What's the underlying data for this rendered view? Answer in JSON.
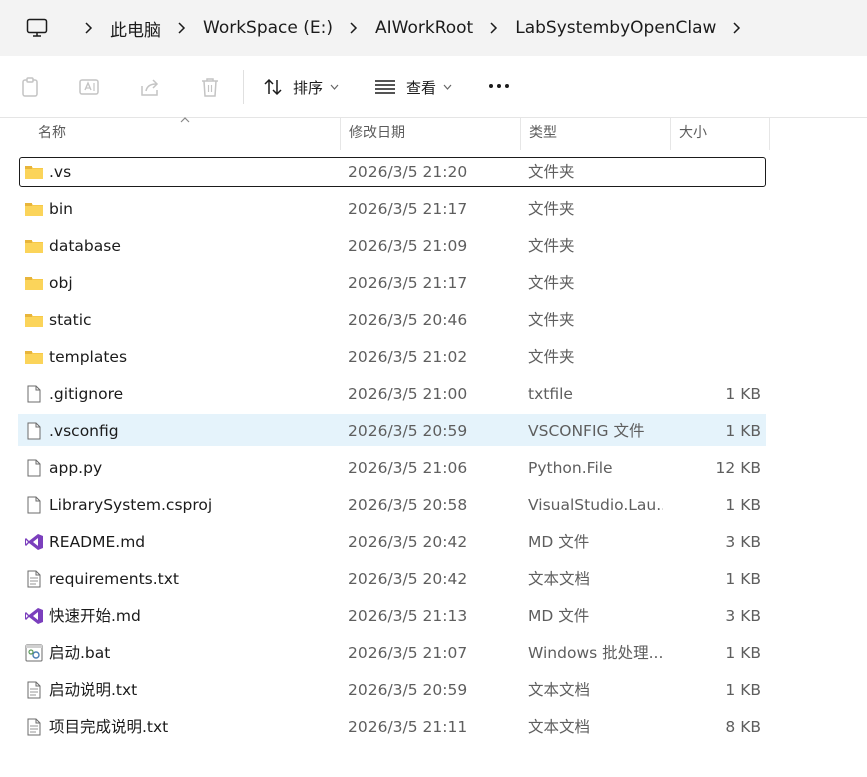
{
  "address": {
    "crumbs": [
      "此电脑",
      "WorkSpace (E:)",
      "AIWorkRoot",
      "LabSystembyOpenClaw"
    ]
  },
  "toolbar": {
    "sort_label": "排序",
    "view_label": "查看"
  },
  "columns": {
    "name": "名称",
    "date": "修改日期",
    "type": "类型",
    "size": "大小"
  },
  "files": [
    {
      "name": ".vs",
      "date": "2026/3/5 21:20",
      "type": "文件夹",
      "size": "",
      "icon": "folder-icon"
    },
    {
      "name": "bin",
      "date": "2026/3/5 21:17",
      "type": "文件夹",
      "size": "",
      "icon": "folder-icon"
    },
    {
      "name": "database",
      "date": "2026/3/5 21:09",
      "type": "文件夹",
      "size": "",
      "icon": "folder-icon"
    },
    {
      "name": "obj",
      "date": "2026/3/5 21:17",
      "type": "文件夹",
      "size": "",
      "icon": "folder-icon"
    },
    {
      "name": "static",
      "date": "2026/3/5 20:46",
      "type": "文件夹",
      "size": "",
      "icon": "folder-icon"
    },
    {
      "name": "templates",
      "date": "2026/3/5 21:02",
      "type": "文件夹",
      "size": "",
      "icon": "folder-icon"
    },
    {
      "name": ".gitignore",
      "date": "2026/3/5 21:00",
      "type": "txtfile",
      "size": "1 KB",
      "icon": "file-icon"
    },
    {
      "name": ".vsconfig",
      "date": "2026/3/5 20:59",
      "type": "VSCONFIG 文件",
      "size": "1 KB",
      "icon": "file-icon"
    },
    {
      "name": "app.py",
      "date": "2026/3/5 21:06",
      "type": "Python.File",
      "size": "12 KB",
      "icon": "file-icon"
    },
    {
      "name": "LibrarySystem.csproj",
      "date": "2026/3/5 20:58",
      "type": "VisualStudio.Lau...",
      "size": "1 KB",
      "icon": "file-icon"
    },
    {
      "name": "README.md",
      "date": "2026/3/5 20:42",
      "type": "MD 文件",
      "size": "3 KB",
      "icon": "visual-studio-icon"
    },
    {
      "name": "requirements.txt",
      "date": "2026/3/5 20:42",
      "type": "文本文档",
      "size": "1 KB",
      "icon": "text-file-icon"
    },
    {
      "name": "快速开始.md",
      "date": "2026/3/5 21:13",
      "type": "MD 文件",
      "size": "3 KB",
      "icon": "visual-studio-icon"
    },
    {
      "name": "启动.bat",
      "date": "2026/3/5 21:07",
      "type": "Windows 批处理...",
      "size": "1 KB",
      "icon": "batch-file-icon"
    },
    {
      "name": "启动说明.txt",
      "date": "2026/3/5 20:59",
      "type": "文本文档",
      "size": "1 KB",
      "icon": "text-file-icon"
    },
    {
      "name": "项目完成说明.txt",
      "date": "2026/3/5 21:11",
      "type": "文本文档",
      "size": "8 KB",
      "icon": "text-file-icon"
    }
  ],
  "focused_row": 0,
  "hover_row": 7
}
